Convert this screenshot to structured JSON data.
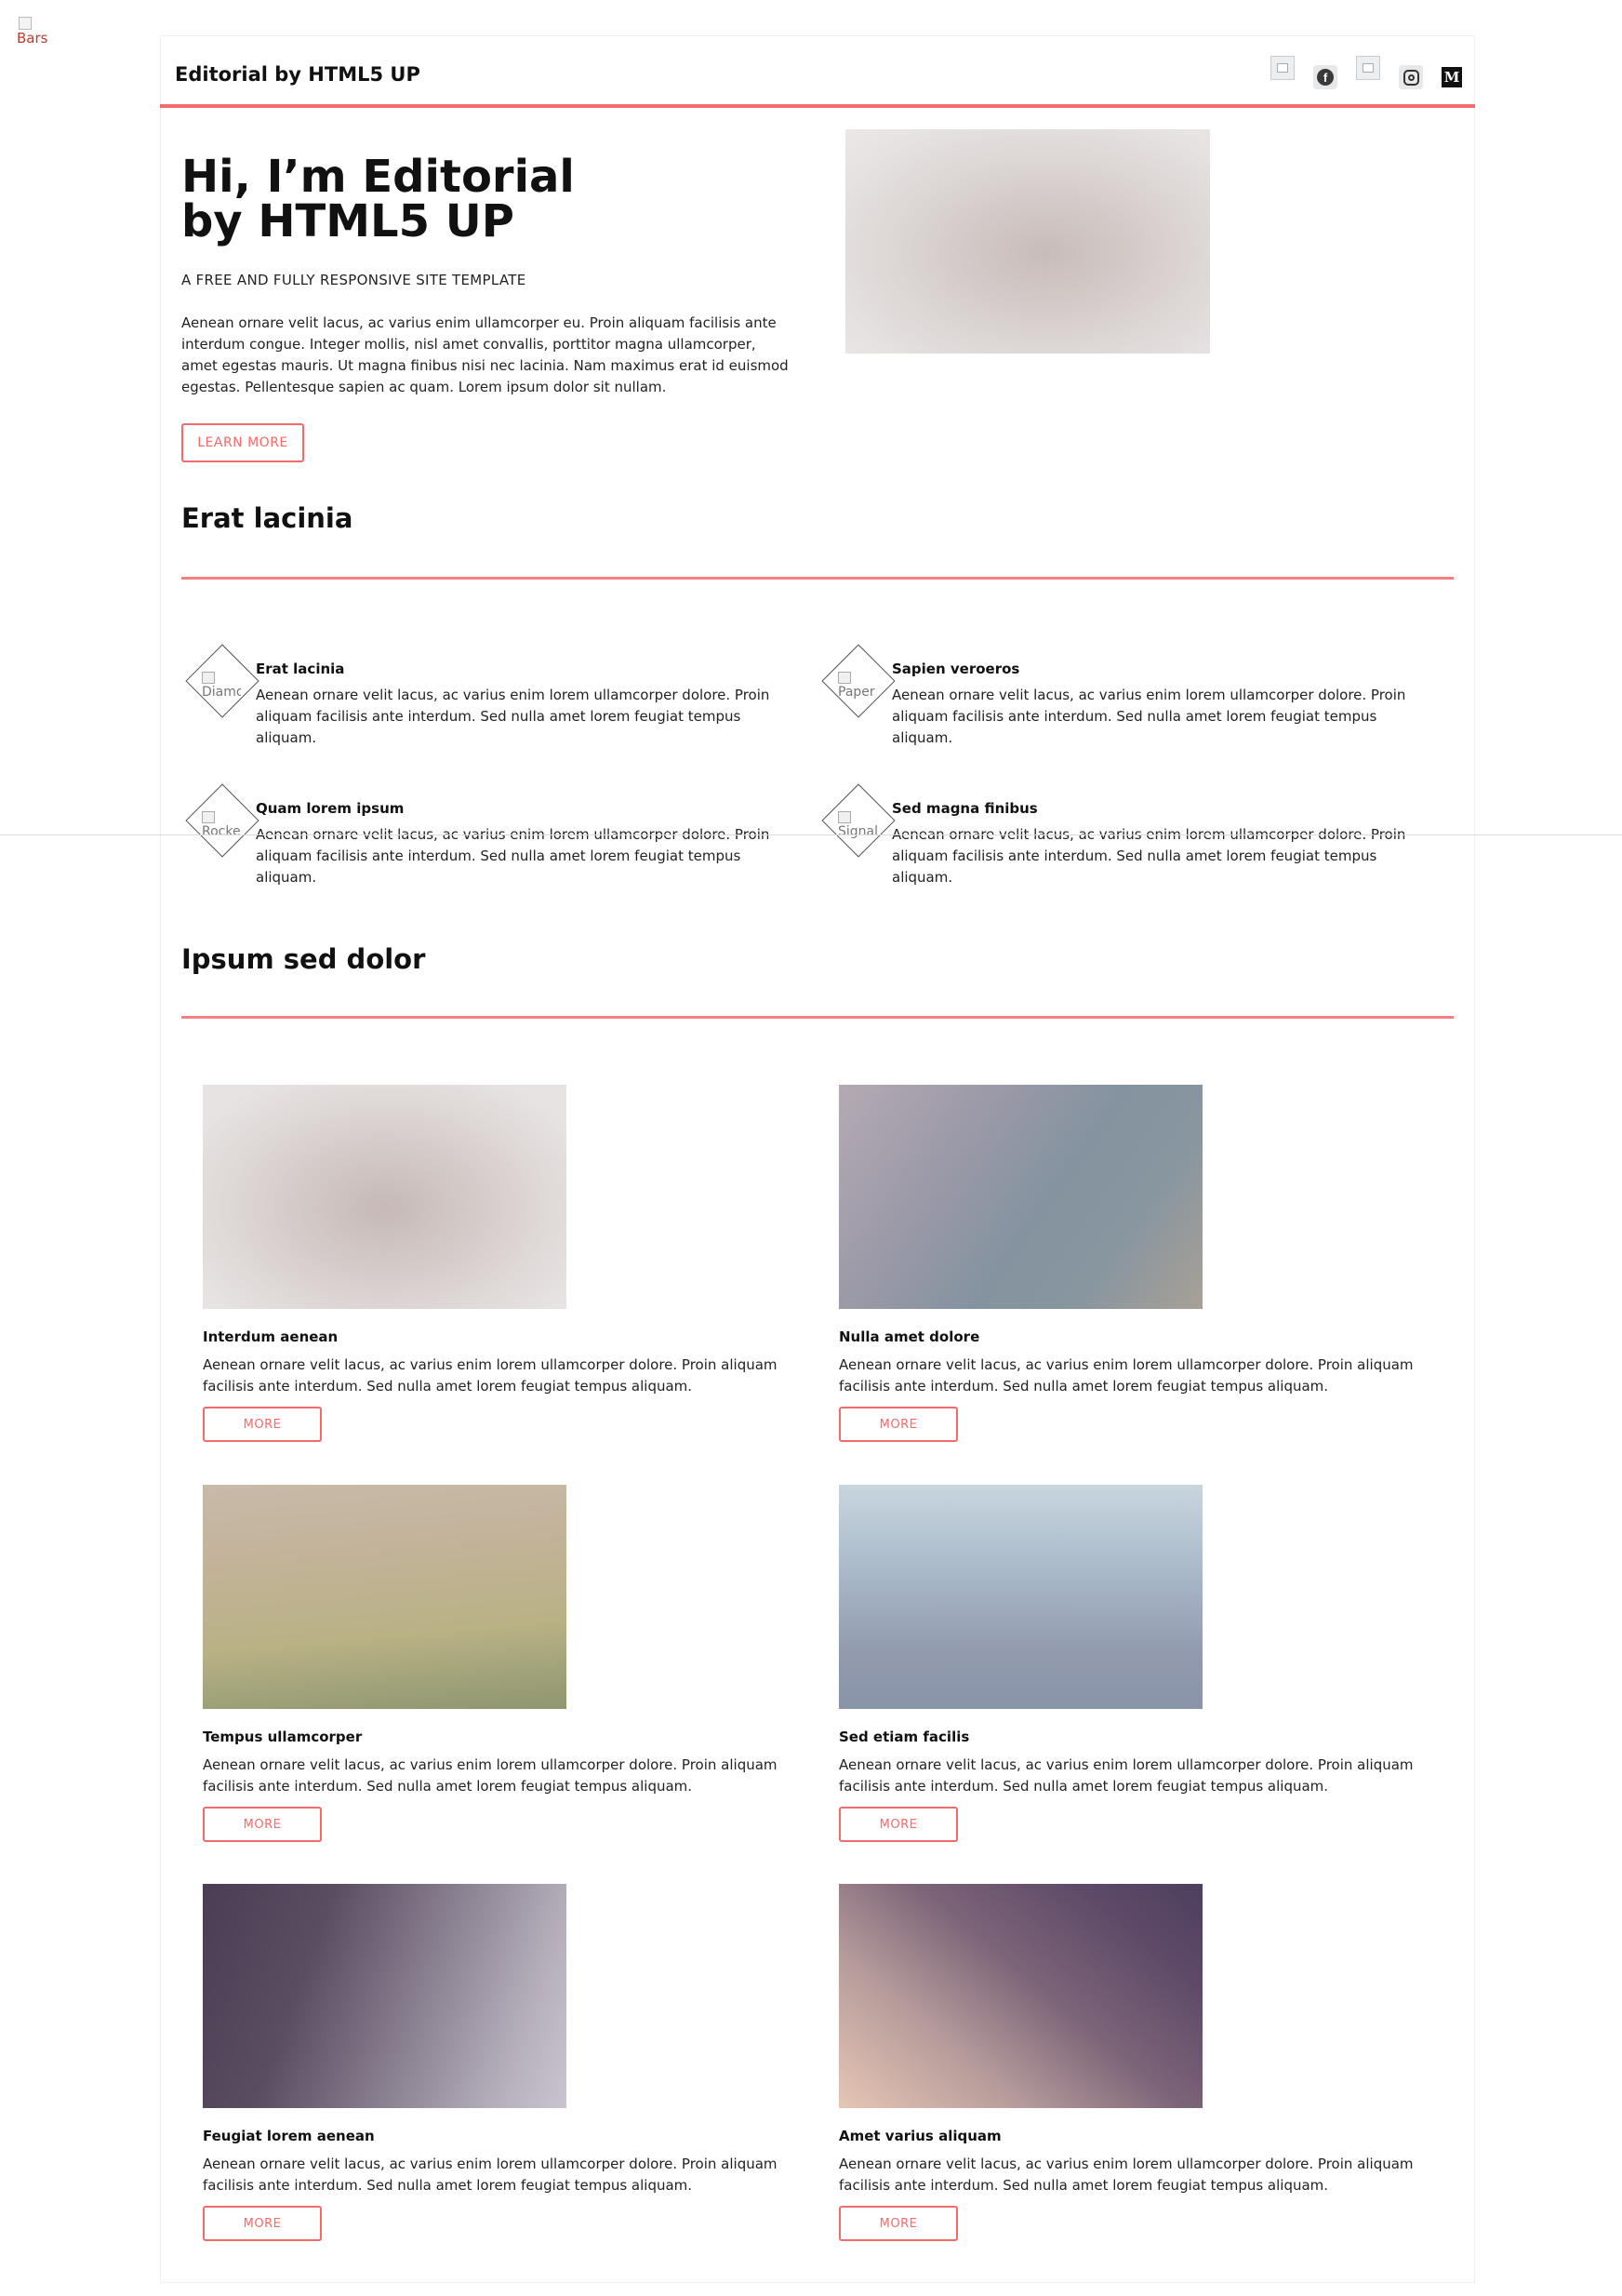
{
  "bars_icon": {
    "alt": "Bars"
  },
  "header": {
    "logo": "Editorial by HTML5 UP",
    "social_icons": [
      "broken-image-icon",
      "facebook-icon",
      "broken-image-icon",
      "instagram-icon",
      "medium-icon"
    ],
    "medium_letter": "M",
    "facebook_letter": "f"
  },
  "banner": {
    "title_line1": "Hi, I’m Editorial",
    "title_line2": "by HTML5 UP",
    "subtitle": "A FREE AND FULLY RESPONSIVE SITE TEMPLATE",
    "text": "Aenean ornare velit lacus, ac varius enim ullamcorper eu. Proin aliquam facilisis ante interdum congue. Integer mollis, nisl amet convallis, porttitor magna ullamcorper, amet egestas mauris. Ut magna finibus nisi nec lacinia. Nam maximus erat id euismod egestas. Pellentesque sapien ac quam. Lorem ipsum dolor sit nullam.",
    "button": "LEARN MORE"
  },
  "features_section": {
    "title": "Erat lacinia",
    "items": [
      {
        "icon_alt": "Diamond",
        "title": "Erat lacinia",
        "text": "Aenean ornare velit lacus, ac varius enim lorem ullamcorper dolore. Proin aliquam facilisis ante interdum. Sed nulla amet lorem feugiat tempus aliquam."
      },
      {
        "icon_alt": "Paper",
        "title": "Sapien veroeros",
        "text": "Aenean ornare velit lacus, ac varius enim lorem ullamcorper dolore. Proin aliquam facilisis ante interdum. Sed nulla amet lorem feugiat tempus aliquam."
      },
      {
        "icon_alt": "Rocket",
        "title": "Quam lorem ipsum",
        "text": "Aenean ornare velit lacus, ac varius enim lorem ullamcorper dolore. Proin aliquam facilisis ante interdum. Sed nulla amet lorem feugiat tempus aliquam."
      },
      {
        "icon_alt": "Signal",
        "title": "Sed magna finibus",
        "text": "Aenean ornare velit lacus, ac varius enim lorem ullamcorper dolore. Proin aliquam facilisis ante interdum. Sed nulla amet lorem feugiat tempus aliquam."
      }
    ]
  },
  "posts_section": {
    "title": "Ipsum sed dolor",
    "button": "MORE",
    "posts": [
      {
        "title": "Interdum aenean",
        "text": "Aenean ornare velit lacus, ac varius enim lorem ullamcorper dolore. Proin aliquam facilisis ante interdum. Sed nulla amet lorem feugiat tempus aliquam."
      },
      {
        "title": "Nulla amet dolore",
        "text": "Aenean ornare velit lacus, ac varius enim lorem ullamcorper dolore. Proin aliquam facilisis ante interdum. Sed nulla amet lorem feugiat tempus aliquam."
      },
      {
        "title": "Tempus ullamcorper",
        "text": "Aenean ornare velit lacus, ac varius enim lorem ullamcorper dolore. Proin aliquam facilisis ante interdum. Sed nulla amet lorem feugiat tempus aliquam."
      },
      {
        "title": "Sed etiam facilis",
        "text": "Aenean ornare velit lacus, ac varius enim lorem ullamcorper dolore. Proin aliquam facilisis ante interdum. Sed nulla amet lorem feugiat tempus aliquam."
      },
      {
        "title": "Feugiat lorem aenean",
        "text": "Aenean ornare velit lacus, ac varius enim lorem ullamcorper dolore. Proin aliquam facilisis ante interdum. Sed nulla amet lorem feugiat tempus aliquam."
      },
      {
        "title": "Amet varius aliquam",
        "text": "Aenean ornare velit lacus, ac varius enim lorem ullamcorper dolore. Proin aliquam facilisis ante interdum. Sed nulla amet lorem feugiat tempus aliquam."
      }
    ]
  },
  "colors": {
    "accent": "#f56a6a",
    "text": "#222222",
    "heading": "#111111"
  }
}
